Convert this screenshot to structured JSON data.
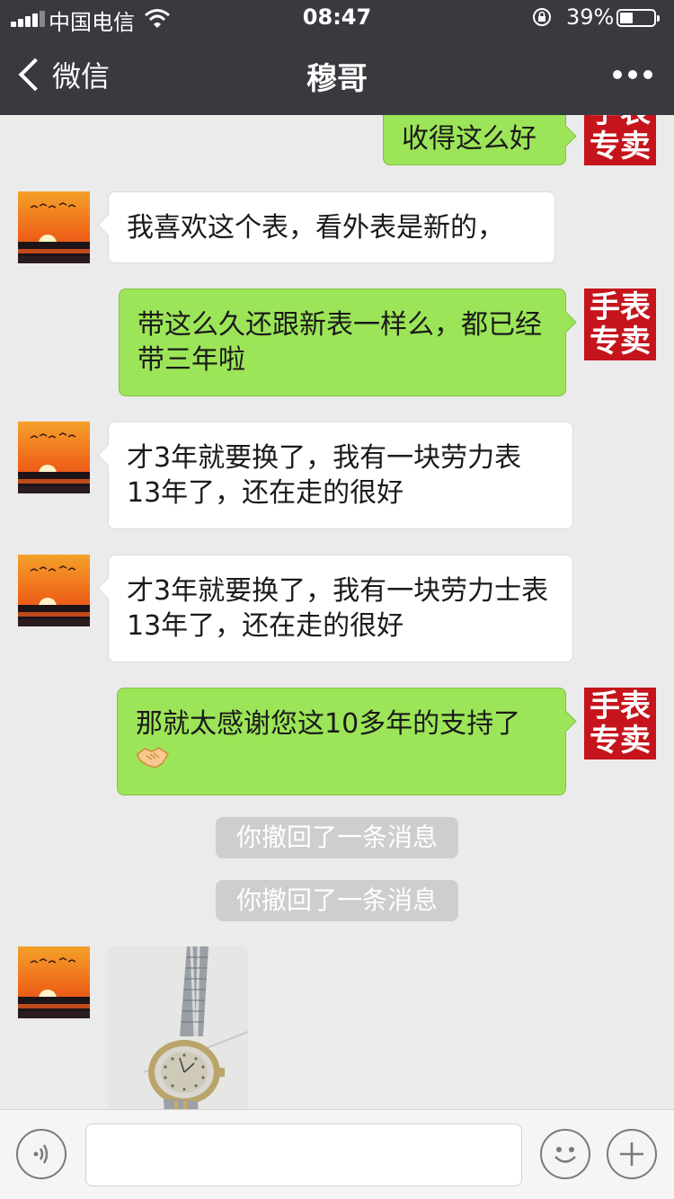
{
  "status_bar": {
    "carrier": "中国电信",
    "time": "08:47",
    "battery_percent": "39%",
    "battery_level": 0.39
  },
  "nav": {
    "back_label": "微信",
    "title": "穆哥",
    "more_icon": "ellipsis-icon"
  },
  "store_avatar_text": {
    "line1": "手表",
    "line2": "专卖"
  },
  "messages": [
    {
      "side": "right",
      "text": "收得这么好"
    },
    {
      "side": "left",
      "text": "我喜欢这个表，看外表是新的，"
    },
    {
      "side": "right",
      "text": "带这么久还跟新表一样么，都已经带三年啦"
    },
    {
      "side": "left",
      "text": "才3年就要换了，我有一块劳力表13年了，还在走的很好"
    },
    {
      "side": "left",
      "text": "才3年就要换了，我有一块劳力士表13年了，还在走的很好"
    },
    {
      "side": "right",
      "text": "那就太感谢您这10多年的支持了",
      "emoji": "handshake-emoji"
    },
    {
      "type": "notice",
      "text": "你撤回了一条消息"
    },
    {
      "type": "notice",
      "text": "你撤回了一条消息"
    },
    {
      "side": "left",
      "type": "image",
      "image": "wristwatch-photo"
    }
  ],
  "input_bar": {
    "voice_icon": "voice-icon",
    "emoji_icon": "smiley-icon",
    "plus_icon": "plus-icon",
    "placeholder": ""
  },
  "colors": {
    "header_bg": "#393a3f",
    "chat_bg": "#ebebeb",
    "sent_bubble": "#9ce558",
    "received_bubble": "#ffffff",
    "store_avatar": "#c5141c",
    "notice_bg": "#cecece"
  }
}
